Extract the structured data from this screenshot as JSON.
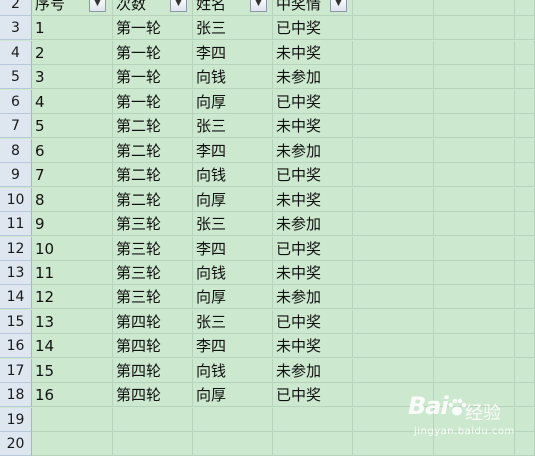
{
  "header": {
    "row_number": "2",
    "columns": [
      "序号",
      "次数",
      "姓名",
      "中奖情"
    ],
    "filter_icon": "dropdown-arrow-icon"
  },
  "rows": [
    {
      "num": "3",
      "cells": [
        "1",
        "第一轮",
        "张三",
        "已中奖"
      ]
    },
    {
      "num": "4",
      "cells": [
        "2",
        "第一轮",
        "李四",
        "未中奖"
      ]
    },
    {
      "num": "5",
      "cells": [
        "3",
        "第一轮",
        "向钱",
        "未参加"
      ]
    },
    {
      "num": "6",
      "cells": [
        "4",
        "第一轮",
        "向厚",
        "已中奖"
      ]
    },
    {
      "num": "7",
      "cells": [
        "5",
        "第二轮",
        "张三",
        "未中奖"
      ]
    },
    {
      "num": "8",
      "cells": [
        "6",
        "第二轮",
        "李四",
        "未参加"
      ]
    },
    {
      "num": "9",
      "cells": [
        "7",
        "第二轮",
        "向钱",
        "已中奖"
      ]
    },
    {
      "num": "10",
      "cells": [
        "8",
        "第二轮",
        "向厚",
        "未中奖"
      ]
    },
    {
      "num": "11",
      "cells": [
        "9",
        "第三轮",
        "张三",
        "未参加"
      ]
    },
    {
      "num": "12",
      "cells": [
        "10",
        "第三轮",
        "李四",
        "已中奖"
      ]
    },
    {
      "num": "13",
      "cells": [
        "11",
        "第三轮",
        "向钱",
        "未中奖"
      ]
    },
    {
      "num": "14",
      "cells": [
        "12",
        "第三轮",
        "向厚",
        "未参加"
      ]
    },
    {
      "num": "15",
      "cells": [
        "13",
        "第四轮",
        "张三",
        "已中奖"
      ]
    },
    {
      "num": "16",
      "cells": [
        "14",
        "第四轮",
        "李四",
        "未中奖"
      ]
    },
    {
      "num": "17",
      "cells": [
        "15",
        "第四轮",
        "向钱",
        "未参加"
      ]
    },
    {
      "num": "18",
      "cells": [
        "16",
        "第四轮",
        "向厚",
        "已中奖"
      ]
    },
    {
      "num": "19",
      "cells": [
        "",
        "",
        "",
        ""
      ]
    },
    {
      "num": "20",
      "cells": [
        "",
        "",
        "",
        ""
      ]
    }
  ],
  "watermark": {
    "logo": "Bai",
    "subtitle": "经验",
    "url": "jingyan.baidu.com"
  },
  "colors": {
    "sheet_background": "#cce8cf",
    "row_header": "#dee6ef",
    "grid": "#b7d3bb"
  }
}
